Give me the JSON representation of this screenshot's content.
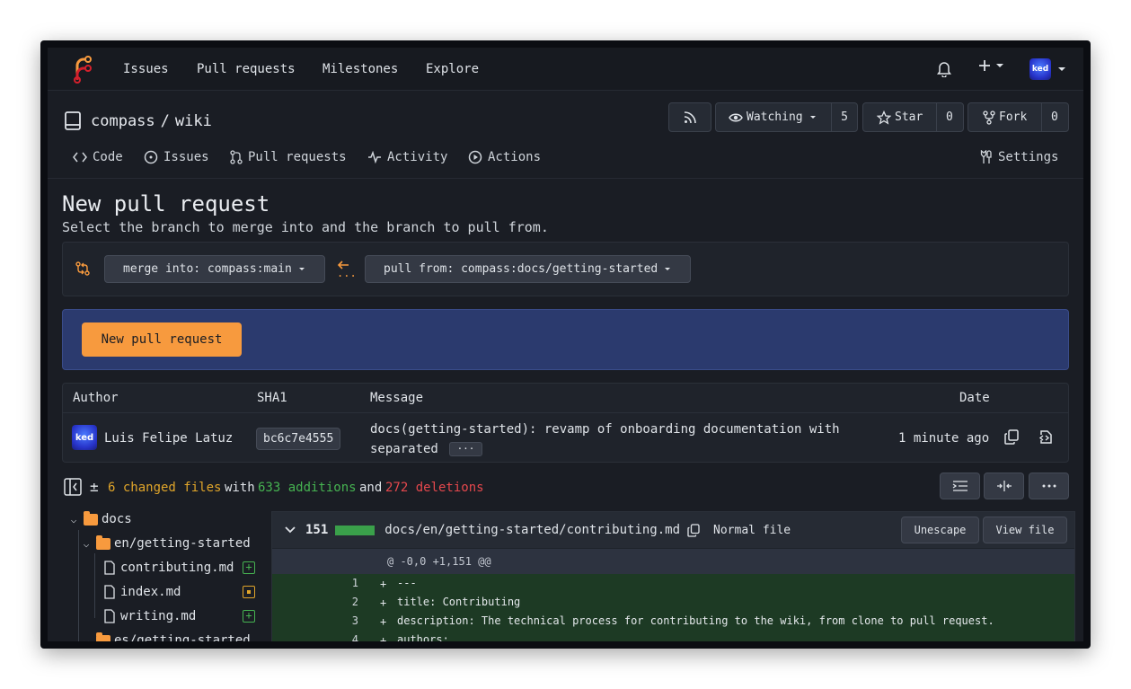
{
  "nav": {
    "links": [
      "Issues",
      "Pull requests",
      "Milestones",
      "Explore"
    ],
    "avatar_text": "ked"
  },
  "repo": {
    "owner": "compass",
    "separator": "/",
    "name": "wiki",
    "watch_label": "Watching",
    "watch_count": "5",
    "star_label": "Star",
    "star_count": "0",
    "fork_label": "Fork",
    "fork_count": "0"
  },
  "tabs": {
    "code": "Code",
    "issues": "Issues",
    "pulls": "Pull requests",
    "activity": "Activity",
    "actions": "Actions",
    "settings": "Settings"
  },
  "page": {
    "title": "New pull request",
    "subtitle": "Select the branch to merge into and the branch to pull from."
  },
  "branches": {
    "merge_into": "merge into: compass:main",
    "pull_from": "pull from: compass:docs/getting-started",
    "arrow_dots": "..."
  },
  "pr_button": "New pull request",
  "commits": {
    "headers": {
      "author": "Author",
      "sha": "SHA1",
      "message": "Message",
      "date": "Date"
    },
    "row": {
      "author": "Luis Felipe Latuz",
      "sha": "bc6c7e4555",
      "message_line1": "docs(getting-started): revamp of onboarding documentation with",
      "message_line2": "separated",
      "ellipsis": "···",
      "date": "1 minute ago"
    }
  },
  "diffstats": {
    "plusminus": "±",
    "changed": "6 changed files",
    "with": "with",
    "additions": "633 additions",
    "and": "and",
    "deletions": "272 deletions"
  },
  "tree": {
    "docs": "docs",
    "en": "en/getting-started",
    "f1": "contributing.md",
    "f2": "index.md",
    "f3": "writing.md",
    "es": "es/getting-started",
    "add_symbol": "+"
  },
  "file": {
    "count": "151",
    "path": "docs/en/getting-started/contributing.md",
    "mode": "Normal file",
    "unescape": "Unescape",
    "view": "View file",
    "hunk": "@ -0,0 +1,151 @@",
    "lines": [
      {
        "num": "1",
        "sign": "+",
        "code": "---"
      },
      {
        "num": "2",
        "sign": "+",
        "code": "title: Contributing"
      },
      {
        "num": "3",
        "sign": "+",
        "code": "description: The technical process for contributing to the wiki, from clone to pull request."
      },
      {
        "num": "4",
        "sign": "+",
        "code": "authors:"
      }
    ]
  },
  "colors": {
    "accent": "#f79a3e",
    "additions": "#46b351",
    "deletions": "#e5484d",
    "changed": "#e0a52a",
    "banner": "#2b3a6e"
  }
}
